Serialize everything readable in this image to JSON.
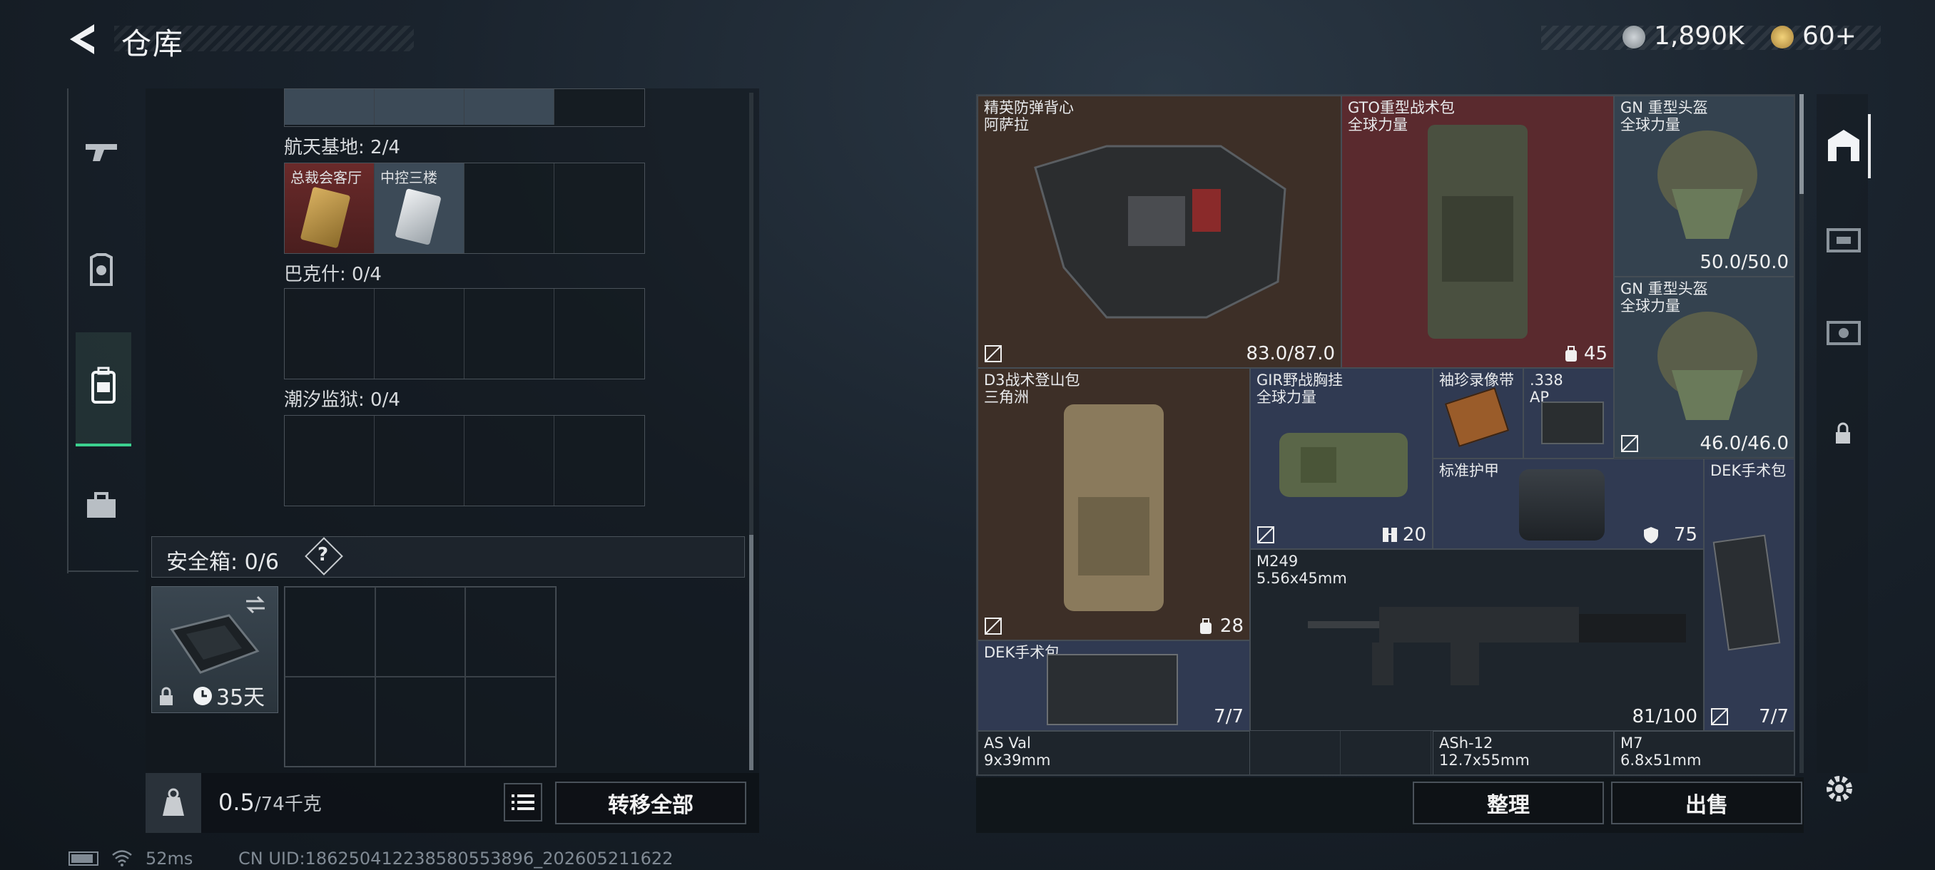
{
  "header": {
    "title": "仓库"
  },
  "currency": {
    "silver": "1,890K",
    "gold": "60+"
  },
  "left_panel": {
    "sections": [
      {
        "label": "航天基地: 2/4",
        "items": [
          "总裁会客厅",
          "中控三楼"
        ]
      },
      {
        "label": "巴克什: 0/4"
      },
      {
        "label": "潮汐监狱: 0/4"
      }
    ],
    "safe_box": {
      "label": "安全箱: 0/6",
      "help": "?",
      "days": "35天"
    },
    "weight": {
      "current": "0.5",
      "max": "/74千克"
    },
    "transfer_all": "转移全部"
  },
  "grid_items": [
    {
      "name": "精英防弹背心\n阿萨拉",
      "value": "83.0/87.0"
    },
    {
      "name": "GTO重型战术包\n全球力量",
      "value": "45"
    },
    {
      "name": "GN 重型头盔\n全球力量",
      "value": "50.0/50.0"
    },
    {
      "name": "GN 重型头盔\n全球力量",
      "value": "46.0/46.0"
    },
    {
      "name": "D3战术登山包\n三角洲",
      "value": "28"
    },
    {
      "name": "GIR野战胸挂\n全球力量",
      "value": "20"
    },
    {
      "name": "袖珍录像带",
      "value": ""
    },
    {
      "name": ".338\nAP",
      "value": ""
    },
    {
      "name": "标准护甲",
      "value": "75"
    },
    {
      "name": "DEK手术包",
      "value": "7/7"
    },
    {
      "name": "M249\n5.56x45mm",
      "value": "81/100"
    },
    {
      "name": "DEK手术包",
      "value": "7/7"
    },
    {
      "name": "AS Val\n9x39mm",
      "value": ""
    },
    {
      "name": "ASh-12\n12.7x55mm",
      "value": ""
    },
    {
      "name": "M7\n6.8x51mm",
      "value": ""
    }
  ],
  "actions": {
    "sort": "整理",
    "sell": "出售"
  },
  "status": {
    "ping": "52ms",
    "uid": "CN UID:18625041223858055389​6_202605211622"
  }
}
